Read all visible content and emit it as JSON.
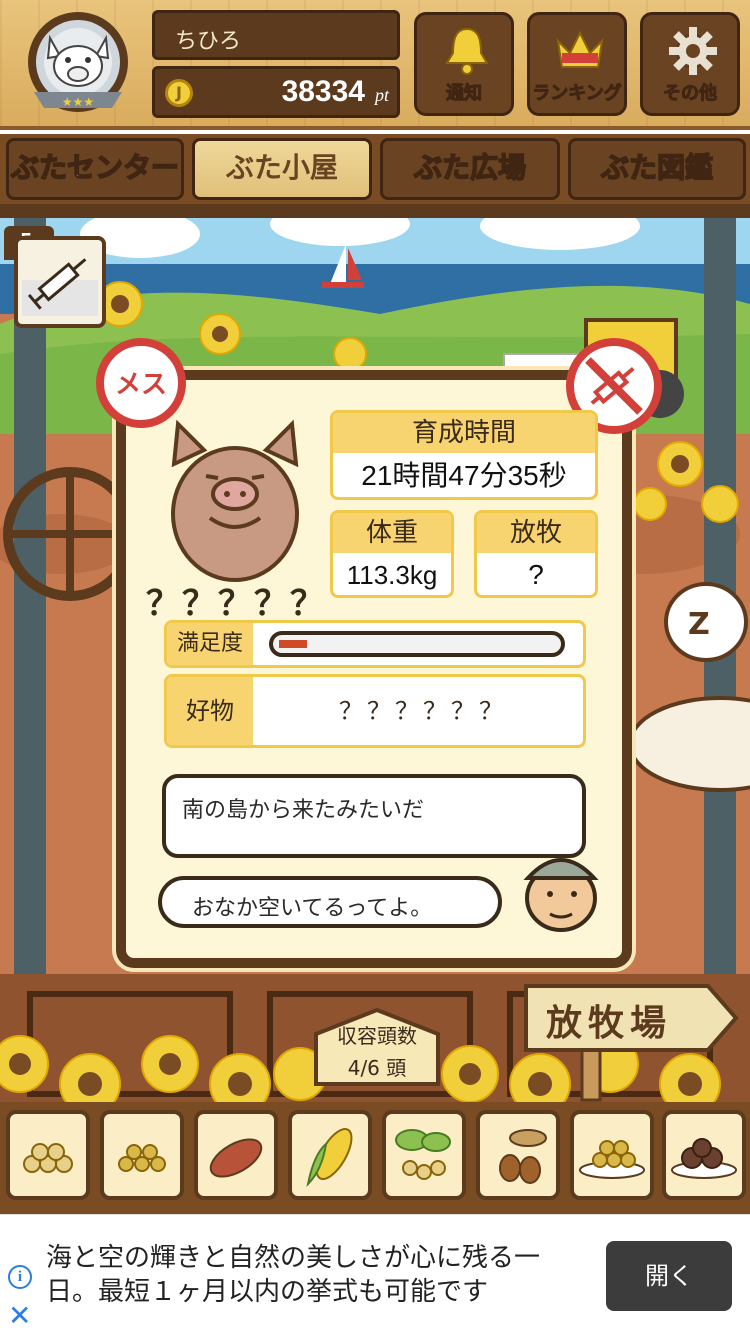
{
  "header": {
    "user_name": "ちひろ",
    "coin_glyph": "J",
    "points": "38334",
    "points_unit": "pt",
    "buttons": [
      {
        "label": "通知",
        "icon": "bell-icon"
      },
      {
        "label": "ランキング",
        "icon": "crown-icon"
      },
      {
        "label": "その他",
        "icon": "gear-icon"
      }
    ]
  },
  "tabs": [
    {
      "label": "ぶたセンター"
    },
    {
      "label": "ぶた小屋",
      "active": true
    },
    {
      "label": "ぶた広場"
    },
    {
      "label": "ぶた図鑑"
    }
  ],
  "syringe": {
    "count": "5",
    "icon": "syringe-icon"
  },
  "pig": {
    "gender": "メス",
    "name": "？？？？？",
    "breeding_time_label": "育成時間",
    "breeding_time": "21時間47分35秒",
    "weight_label": "体重",
    "weight": "113.3kg",
    "grazing_label": "放牧",
    "grazing": "?",
    "satisfaction_label": "満足度",
    "satisfaction_level": 0.1,
    "favorite_label": "好物",
    "favorite": "？？？？？？",
    "message_1": "南の島から来たみたいだ",
    "message_2": "おなか空いてるってよ。"
  },
  "farm": {
    "capacity_label": "収容頭数",
    "capacity_value": "4/6 頭",
    "sign_label": "放牧場"
  },
  "food_items": [
    "soybeans-icon",
    "grain-icon",
    "sweet-potato-icon",
    "corn-icon",
    "herb-beans-icon",
    "acorn-icon",
    "rice-bowl-icon",
    "truffle-icon"
  ],
  "ad": {
    "text": "海と空の輝きと自然の美しさが心に残る一日。最短１ヶ月以内の挙式も可能です",
    "button_label": "開く"
  },
  "colors": {
    "accent": "#f7d470",
    "wood": "#5c3a1e",
    "red": "#d3403a"
  }
}
